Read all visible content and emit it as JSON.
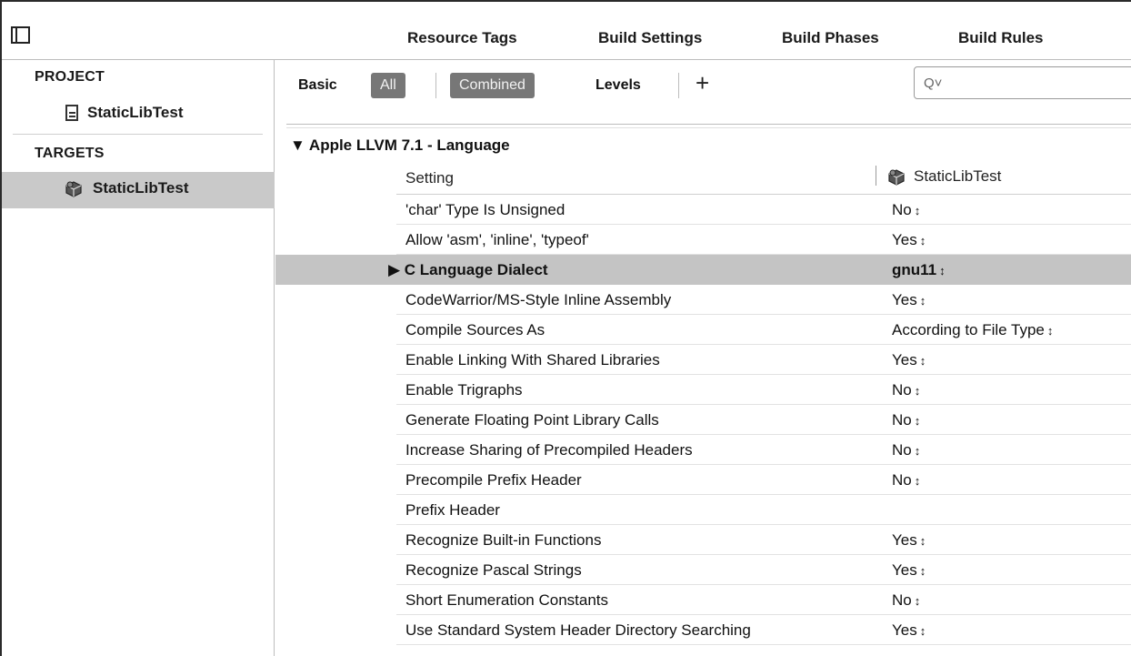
{
  "top_tabs": [
    "Resource Tags",
    "Build Settings",
    "Build Phases",
    "Build Rules"
  ],
  "sidebar": {
    "project_heading": "PROJECT",
    "project_item": "StaticLibTest",
    "targets_heading": "TARGETS",
    "target_item": "StaticLibTest"
  },
  "filter": {
    "basic": "Basic",
    "all": "All",
    "combined": "Combined",
    "levels": "Levels",
    "add": "+",
    "search_glyph": "Q˅"
  },
  "section_title": "▼ Apple LLVM 7.1 - Language",
  "columns": {
    "setting": "Setting",
    "target": "StaticLibTest"
  },
  "stepper_glyph": "↕",
  "rows": [
    {
      "label": "'char' Type Is Unsigned",
      "value": "No"
    },
    {
      "label": "Allow 'asm', 'inline', 'typeof'",
      "value": "Yes"
    },
    {
      "label": "▶ C Language Dialect",
      "value": "gnu11"
    },
    {
      "label": "CodeWarrior/MS-Style Inline Assembly",
      "value": "Yes"
    },
    {
      "label": "Compile Sources As",
      "value": "According to File Type"
    },
    {
      "label": "Enable Linking With Shared Libraries",
      "value": "Yes"
    },
    {
      "label": "Enable Trigraphs",
      "value": "No"
    },
    {
      "label": "Generate Floating Point Library Calls",
      "value": "No"
    },
    {
      "label": "Increase Sharing of Precompiled Headers",
      "value": "No"
    },
    {
      "label": "Precompile Prefix Header",
      "value": "No"
    },
    {
      "label": "Prefix Header",
      "value": ""
    },
    {
      "label": "Recognize Built-in Functions",
      "value": "Yes"
    },
    {
      "label": "Recognize Pascal Strings",
      "value": "Yes"
    },
    {
      "label": "Short Enumeration Constants",
      "value": "No"
    },
    {
      "label": "Use Standard System Header Directory Searching",
      "value": "Yes"
    }
  ],
  "selected_row": 2
}
